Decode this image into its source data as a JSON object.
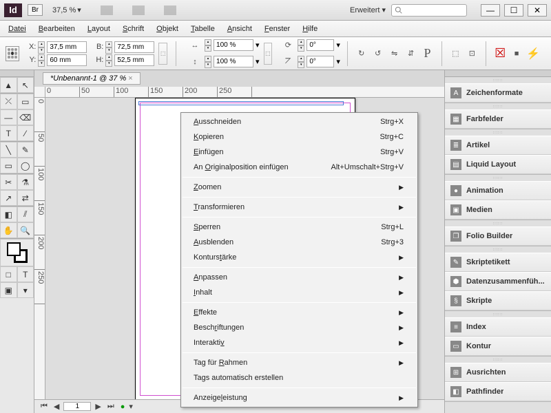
{
  "titlebar": {
    "app_label": "Id",
    "br_label": "Br",
    "zoom": "37,5 %",
    "workspace": "Erweitert"
  },
  "window_buttons": {
    "min": "—",
    "max": "☐",
    "close": "✕"
  },
  "menu": {
    "file": "Datei",
    "edit": "Bearbeiten",
    "layout": "Layout",
    "type": "Schrift",
    "object": "Objekt",
    "table": "Tabelle",
    "view": "Ansicht",
    "window": "Fenster",
    "help": "Hilfe"
  },
  "control": {
    "x_label": "X:",
    "x_val": "37,5 mm",
    "y_label": "Y:",
    "y_val": "60 mm",
    "w_label": "B:",
    "w_val": "72,5 mm",
    "h_label": "H:",
    "h_val": "52,5 mm",
    "sx": "100 %",
    "sy": "100 %",
    "rot_label": "⟳",
    "rot_val": "0°",
    "shear_label": "⦢",
    "shear_val": "0°"
  },
  "document": {
    "tab": "*Unbenannt-1 @ 37 %",
    "ruler_marks": [
      "0",
      "50",
      "100",
      "150",
      "200",
      "250"
    ],
    "page_num": "1"
  },
  "panels": [
    [
      {
        "icon": "A",
        "label": "Zeichenformate"
      }
    ],
    [
      {
        "icon": "▦",
        "label": "Farbfelder"
      }
    ],
    [
      {
        "icon": "≣",
        "label": "Artikel"
      },
      {
        "icon": "▤",
        "label": "Liquid Layout"
      }
    ],
    [
      {
        "icon": "●",
        "label": "Animation"
      },
      {
        "icon": "▣",
        "label": "Medien"
      }
    ],
    [
      {
        "icon": "❐",
        "label": "Folio Builder"
      }
    ],
    [
      {
        "icon": "✎",
        "label": "Skriptetikett"
      },
      {
        "icon": "⬢",
        "label": "Datenzusammenfüh..."
      },
      {
        "icon": "§",
        "label": "Skripte"
      }
    ],
    [
      {
        "icon": "≡",
        "label": "Index"
      },
      {
        "icon": "▭",
        "label": "Kontur"
      }
    ],
    [
      {
        "icon": "⊞",
        "label": "Ausrichten"
      },
      {
        "icon": "◧",
        "label": "Pathfinder"
      }
    ]
  ],
  "contextmenu": [
    {
      "type": "item",
      "label": "Ausschneiden",
      "u": 0,
      "short": "Strg+X"
    },
    {
      "type": "item",
      "label": "Kopieren",
      "u": 0,
      "short": "Strg+C"
    },
    {
      "type": "item",
      "label": "Einfügen",
      "u": 0,
      "short": "Strg+V"
    },
    {
      "type": "item",
      "label": "An Originalposition einfügen",
      "u": 3,
      "short": "Alt+Umschalt+Strg+V"
    },
    {
      "type": "sep"
    },
    {
      "type": "item",
      "label": "Zoomen",
      "u": 0,
      "sub": true
    },
    {
      "type": "sep"
    },
    {
      "type": "item",
      "label": "Transformieren",
      "u": 0,
      "sub": true
    },
    {
      "type": "sep"
    },
    {
      "type": "item",
      "label": "Sperren",
      "u": 0,
      "short": "Strg+L"
    },
    {
      "type": "item",
      "label": "Ausblenden",
      "u": 0,
      "short": "Strg+3"
    },
    {
      "type": "item",
      "label": "Konturstärke",
      "u": 7,
      "sub": true
    },
    {
      "type": "sep"
    },
    {
      "type": "item",
      "label": "Anpassen",
      "u": 0,
      "sub": true
    },
    {
      "type": "item",
      "label": "Inhalt",
      "u": 0,
      "sub": true
    },
    {
      "type": "sep"
    },
    {
      "type": "item",
      "label": "Effekte",
      "u": 0,
      "sub": true
    },
    {
      "type": "item",
      "label": "Beschriftungen",
      "u": 5,
      "sub": true
    },
    {
      "type": "item",
      "label": "Interaktiv",
      "u": 9,
      "sub": true
    },
    {
      "type": "sep"
    },
    {
      "type": "item",
      "label": "Tag für Rahmen",
      "u": 8,
      "sub": true
    },
    {
      "type": "item",
      "label": "Tags automatisch erstellen",
      "u": -1
    },
    {
      "type": "sep"
    },
    {
      "type": "item",
      "label": "Anzeigeleistung",
      "u": 7,
      "sub": true
    }
  ]
}
